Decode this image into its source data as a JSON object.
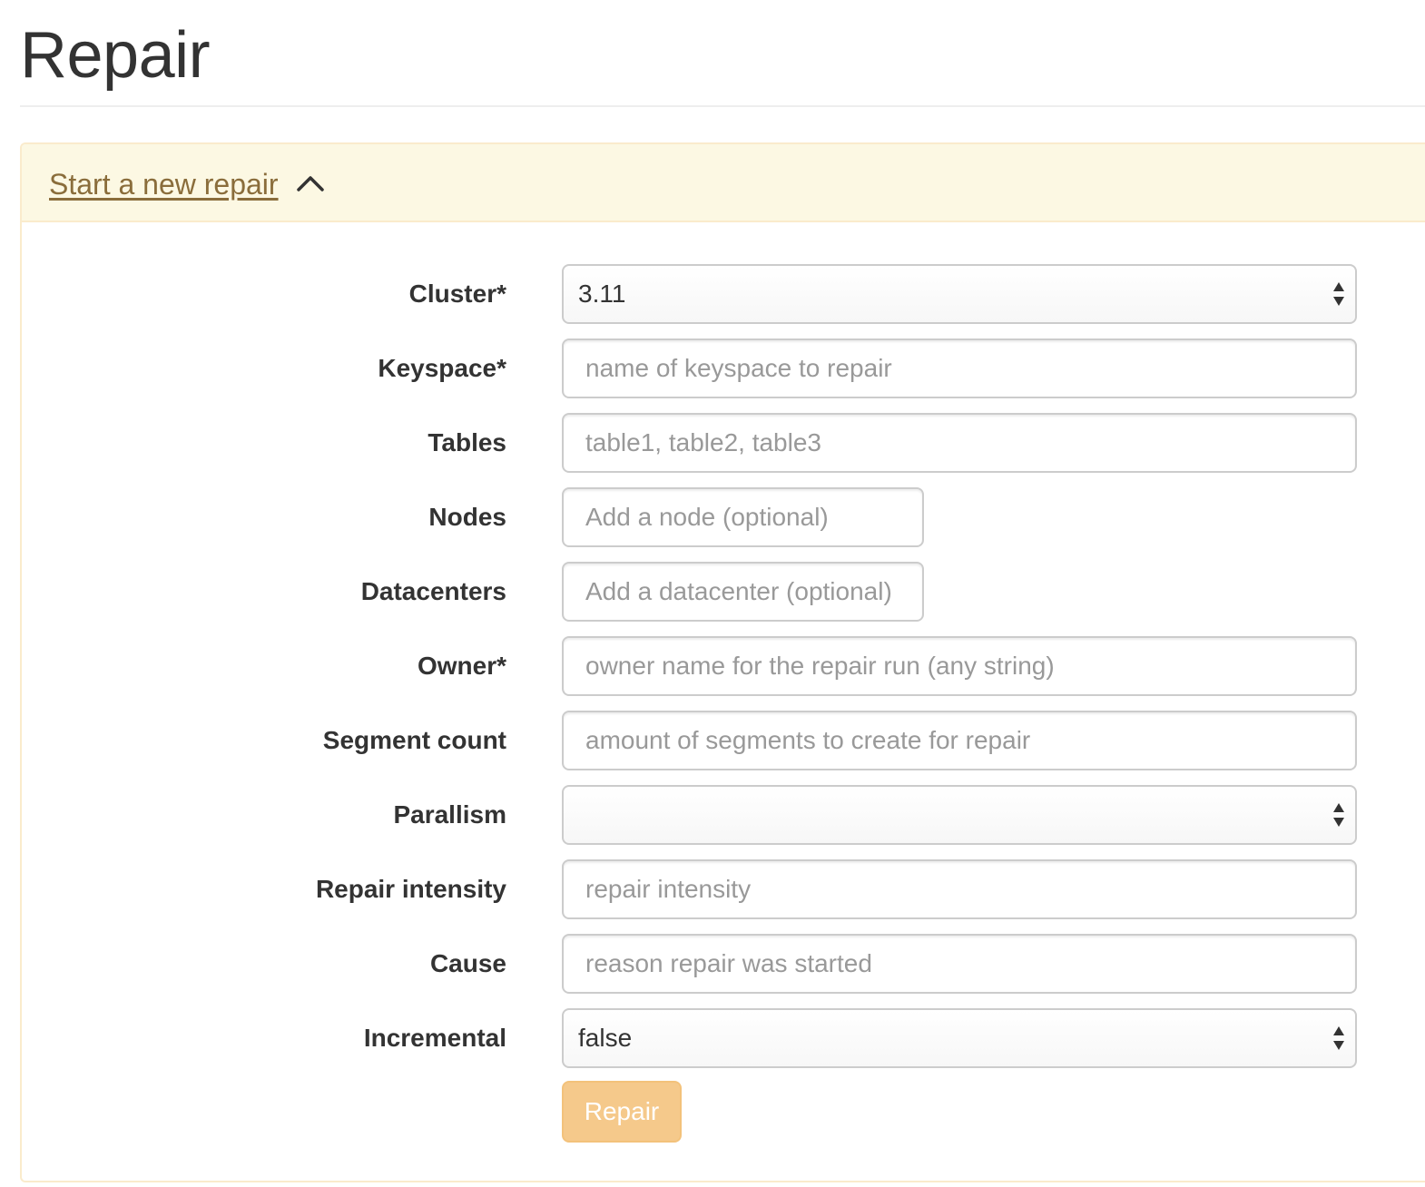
{
  "page": {
    "title": "Repair"
  },
  "panel": {
    "heading_link": "Start a new repair",
    "heading_icon": "chevron-up-icon"
  },
  "form": {
    "cluster": {
      "label": "Cluster*",
      "value": "3.11"
    },
    "keyspace": {
      "label": "Keyspace*",
      "placeholder": "name of keyspace to repair"
    },
    "tables": {
      "label": "Tables",
      "placeholder": "table1, table2, table3"
    },
    "nodes": {
      "label": "Nodes",
      "placeholder": "Add a node (optional)"
    },
    "datacenters": {
      "label": "Datacenters",
      "placeholder": "Add a datacenter (optional)"
    },
    "owner": {
      "label": "Owner*",
      "placeholder": "owner name for the repair run (any string)"
    },
    "segment_count": {
      "label": "Segment count",
      "placeholder": "amount of segments to create for repair"
    },
    "parallism": {
      "label": "Parallism",
      "value": ""
    },
    "repair_intensity": {
      "label": "Repair intensity",
      "placeholder": "repair intensity"
    },
    "cause": {
      "label": "Cause",
      "placeholder": "reason repair was started"
    },
    "incremental": {
      "label": "Incremental",
      "value": "false"
    },
    "submit_label": "Repair"
  },
  "colors": {
    "panel_heading_bg": "#fcf8e3",
    "panel_border": "#faebcc",
    "link": "#8a6d3b",
    "warning_button": "#f0ad4e"
  }
}
